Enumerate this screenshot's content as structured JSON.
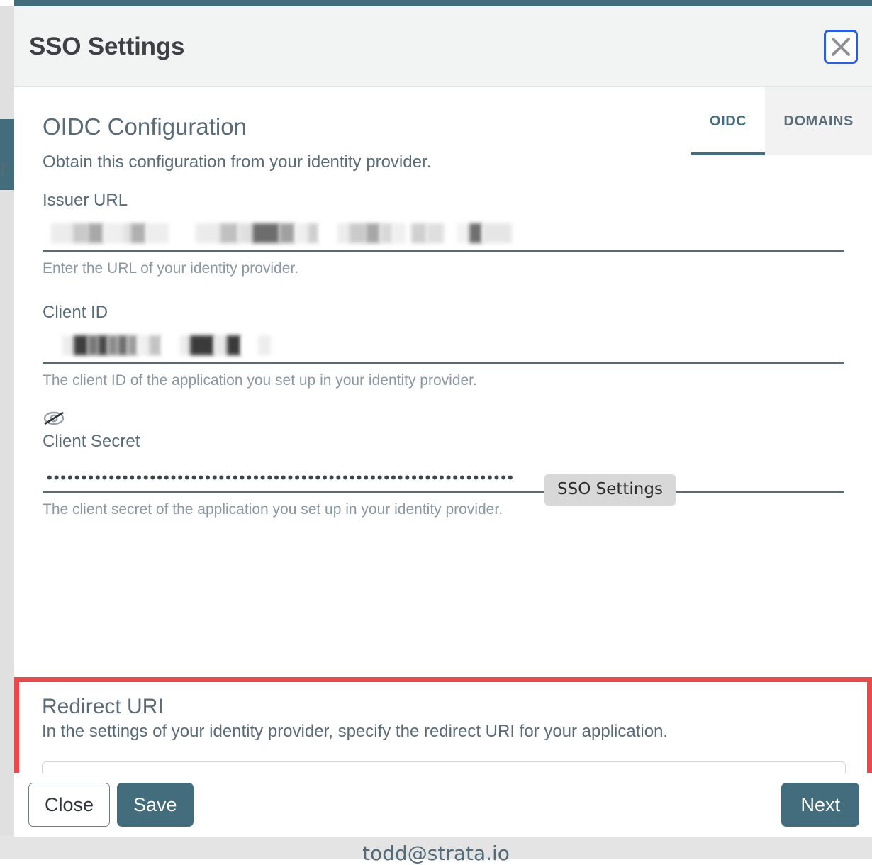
{
  "window": {
    "accent_teal": "#436c7c",
    "highlight_red": "#e64a4a",
    "focus_blue": "#2b5fd9"
  },
  "background": {
    "sidebar_letter": "r",
    "footer_email": "todd@strata.io"
  },
  "modal": {
    "title": "SSO Settings",
    "close_icon": "close-icon"
  },
  "tabs": [
    {
      "label": "OIDC",
      "active": true
    },
    {
      "label": "DOMAINS",
      "active": false
    }
  ],
  "section": {
    "title": "OIDC Configuration",
    "subtitle": "Obtain this configuration from your identity provider."
  },
  "fields": [
    {
      "label": "Issuer URL",
      "value": "",
      "redacted": true,
      "help": "Enter the URL of your identity provider."
    },
    {
      "label": "Client ID",
      "value": "",
      "redacted": true,
      "help": "The client ID of the application you set up in your identity provider."
    },
    {
      "label": "Client Secret",
      "value": "••••••••••••••••••••••••••••••••••••••••••••••••••••••••••••••••••••",
      "redacted": false,
      "help": "The client secret of the application you set up in your identity provider.",
      "icon": "eye-slash-icon"
    }
  ],
  "tooltip": {
    "text": "SSO Settings"
  },
  "redirect": {
    "title": "Redirect URI",
    "subtitle": "In the settings of your identity provider, specify the redirect URI for your application.",
    "value": "",
    "redacted": true,
    "copy_icon": "copy-icon"
  },
  "footer": {
    "close_label": "Close",
    "save_label": "Save",
    "next_label": "Next"
  }
}
